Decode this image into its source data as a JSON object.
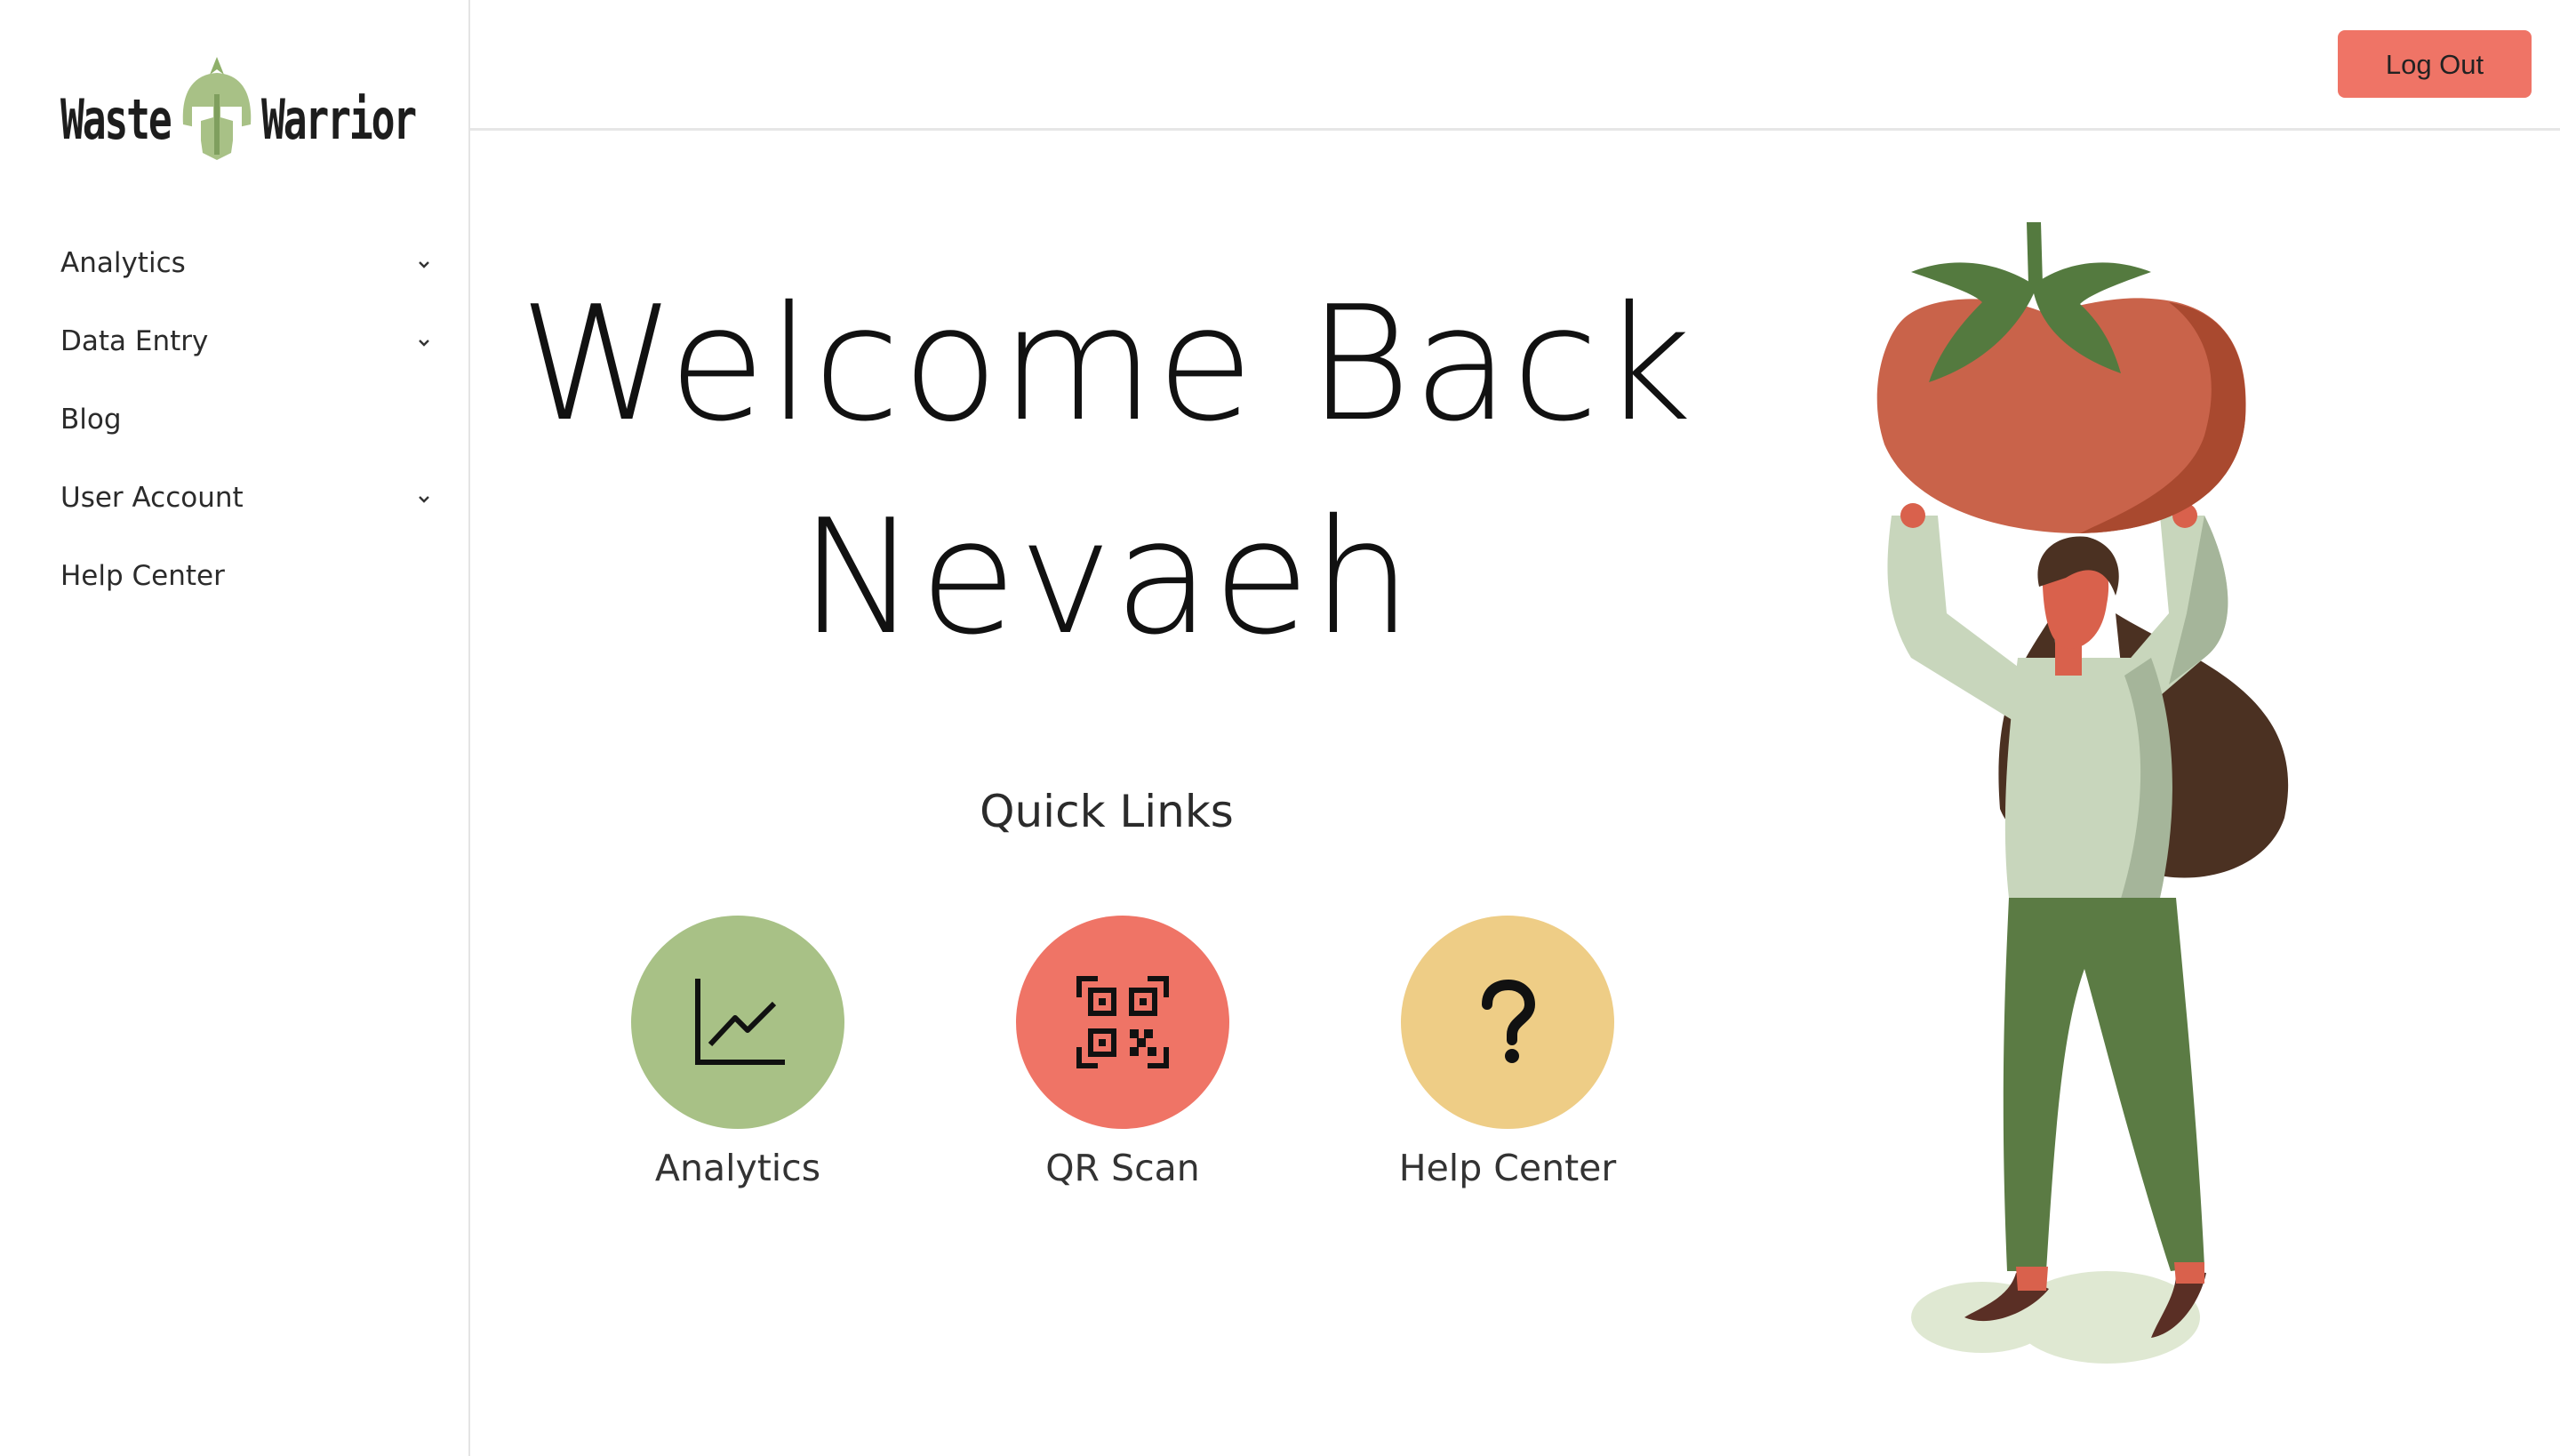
{
  "brand": {
    "word1": "Waste",
    "word2": "Warrior"
  },
  "sidebar": {
    "items": [
      {
        "label": "Analytics",
        "has_submenu": true
      },
      {
        "label": "Data Entry",
        "has_submenu": true
      },
      {
        "label": "Blog",
        "has_submenu": false
      },
      {
        "label": "User Account",
        "has_submenu": true
      },
      {
        "label": "Help Center",
        "has_submenu": false
      }
    ]
  },
  "header": {
    "logout_label": "Log Out"
  },
  "main": {
    "welcome_line1": "Welcome Back",
    "welcome_line2": "Nevaeh",
    "quick_links_title": "Quick Links",
    "quick_links": [
      {
        "label": "Analytics",
        "icon": "line-chart-icon",
        "color": "#a8c186"
      },
      {
        "label": "QR Scan",
        "icon": "qr-code-icon",
        "color": "#ef7466"
      },
      {
        "label": "Help Center",
        "icon": "question-mark-icon",
        "color": "#eecd86"
      }
    ]
  },
  "colors": {
    "accent": "#ef7466",
    "brand_green": "#a8c186",
    "yellow": "#eecd86",
    "tomato": "#c9634a"
  }
}
